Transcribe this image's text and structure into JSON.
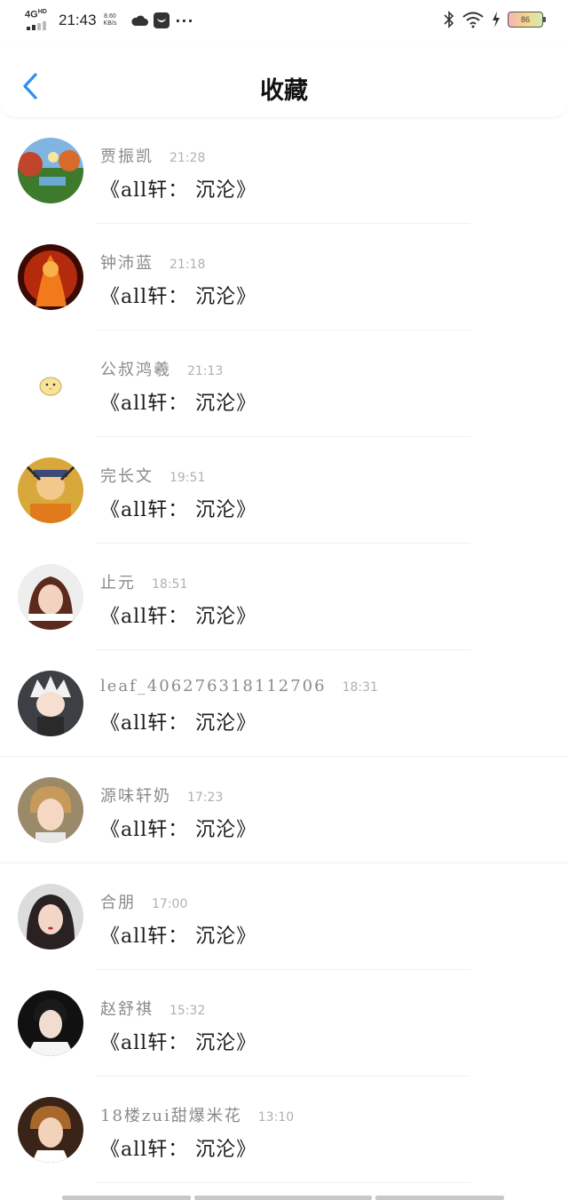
{
  "status_bar": {
    "network": "4G",
    "network_sup": "HD",
    "time": "21:43",
    "speed_value": "8.60",
    "speed_unit": "KB/s",
    "battery": "86",
    "icons": [
      "signal-icon",
      "cloud-icon",
      "mailbox-icon",
      "more-icon",
      "bluetooth-icon",
      "wifi-icon",
      "charging-icon",
      "battery-icon"
    ]
  },
  "header": {
    "title": "收藏",
    "back_icon": "chevron-left-icon",
    "accent": "#2e8ff0"
  },
  "items": [
    {
      "name": "贾振凯",
      "time": "21:28",
      "content": "《all轩： 沉沦》",
      "avatar": "landscape-painting"
    },
    {
      "name": "钟沛蓝",
      "time": "21:18",
      "content": "《all轩： 沉沦》",
      "avatar": "fire-figure"
    },
    {
      "name": "公叔鸿羲",
      "time": "21:13",
      "content": "《all轩： 沉沦》",
      "avatar": "yellow-chick"
    },
    {
      "name": "完长文",
      "time": "19:51",
      "content": "《all轩： 沉沦》",
      "avatar": "anime-ninja"
    },
    {
      "name": "止元",
      "time": "18:51",
      "content": "《all轩： 沉沦》",
      "avatar": "girl-photo"
    },
    {
      "name": "leaf_406276318112706",
      "time": "18:31",
      "content": "《all轩： 沉沦》",
      "avatar": "anime-white-hair"
    },
    {
      "name": "源味轩奶",
      "time": "17:23",
      "content": "《all轩： 沉沦》",
      "avatar": "boy-photo"
    },
    {
      "name": "合朋",
      "time": "17:00",
      "content": "《all轩： 沉沦》",
      "avatar": "girl-photo-2"
    },
    {
      "name": "赵舒祺",
      "time": "15:32",
      "content": "《all轩： 沉沦》",
      "avatar": "boy-photo-2"
    },
    {
      "name": "18楼zui甜爆米花",
      "time": "13:10",
      "content": "《all轩： 沉沦》",
      "avatar": "boy-photo-3"
    }
  ]
}
